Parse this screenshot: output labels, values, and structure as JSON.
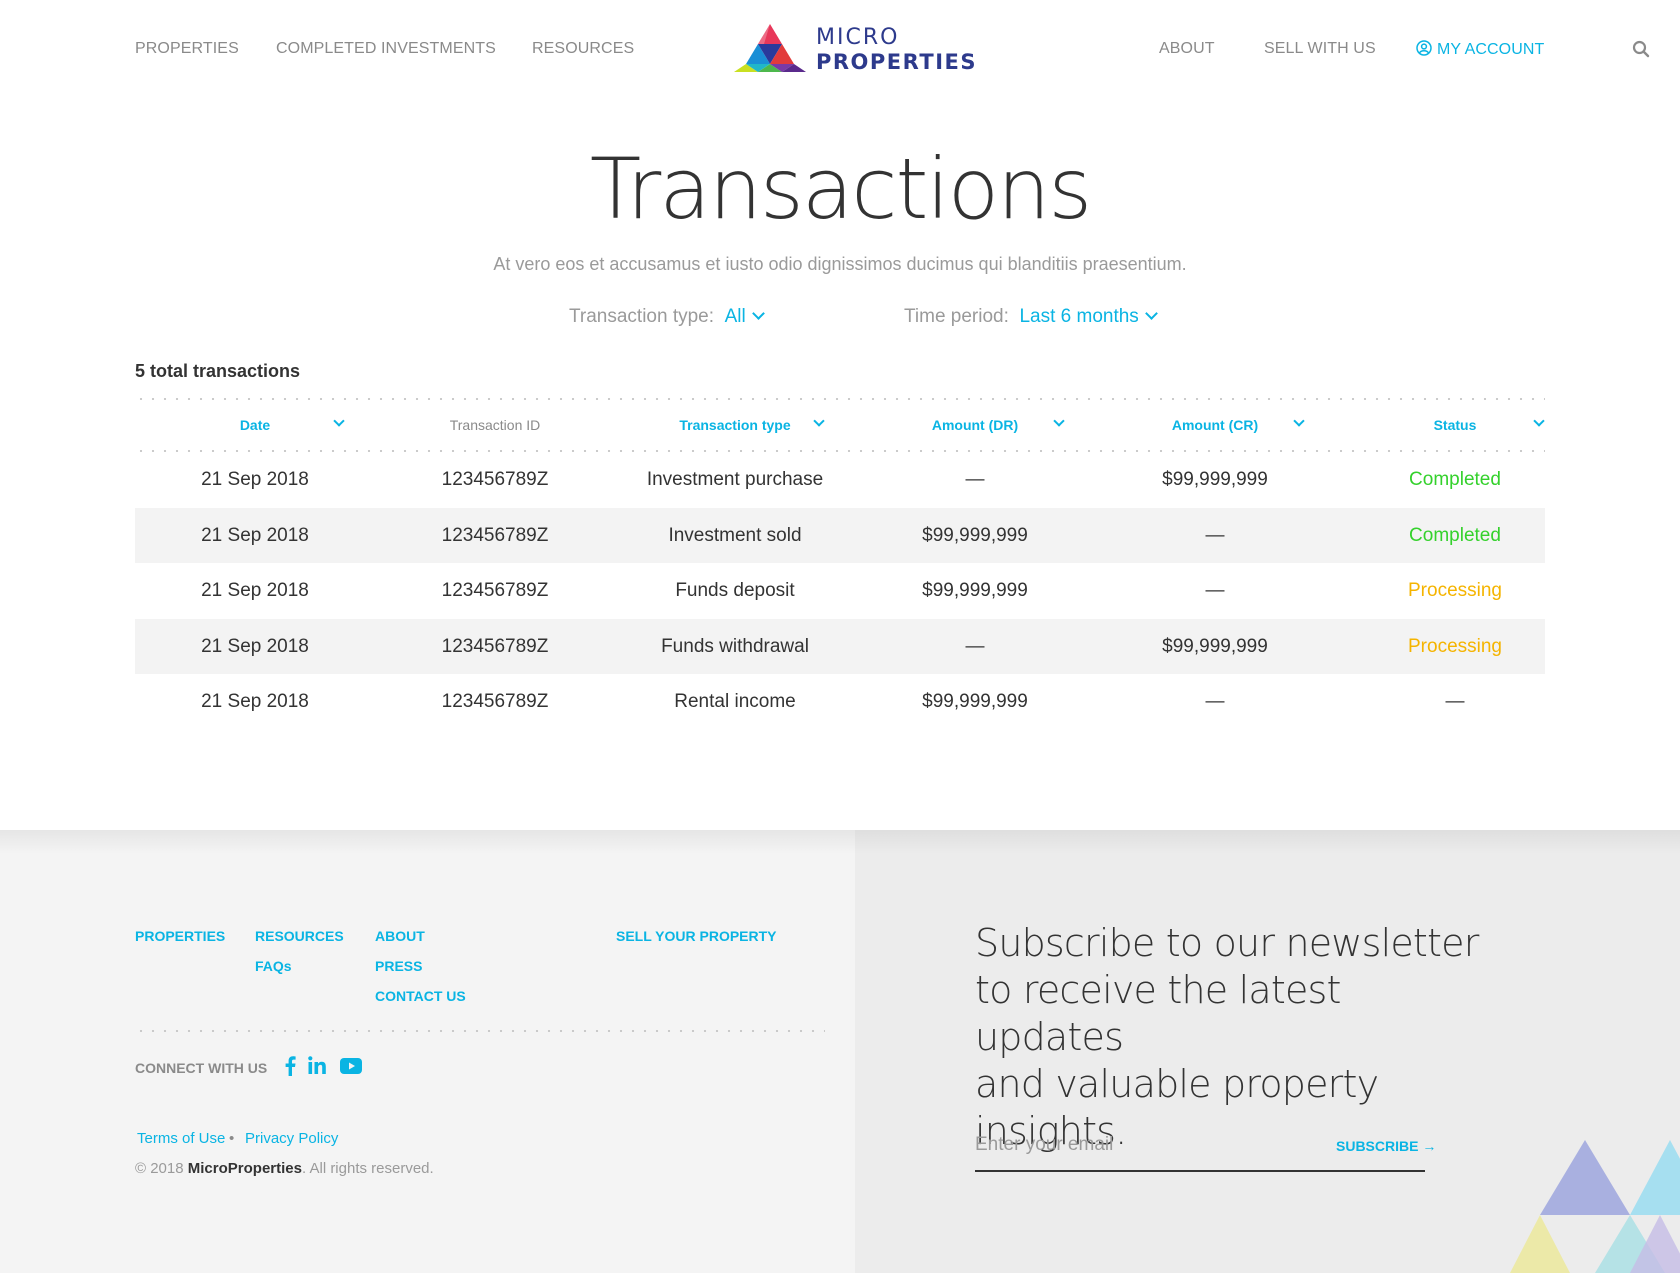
{
  "header": {
    "nav_left": [
      "PROPERTIES",
      "COMPLETED INVESTMENTS",
      "RESOURCES"
    ],
    "logo": {
      "line1": "MICRO",
      "line2": "PROPERTIES"
    },
    "nav_right": [
      "ABOUT",
      "SELL WITH US"
    ],
    "account": "MY ACCOUNT",
    "search_icon": "search-icon"
  },
  "hero": {
    "title": "Transactions",
    "subtitle": "At vero eos et accusamus et iusto odio dignissimos ducimus qui blanditiis praesentium."
  },
  "filters": {
    "type": {
      "label": "Transaction type:",
      "value": "All"
    },
    "period": {
      "label": "Time period:",
      "value": "Last 6 months"
    }
  },
  "total": "5 total transactions",
  "table": {
    "columns": [
      "Date",
      "Transaction ID",
      "Transaction type",
      "Amount (DR)",
      "Amount (CR)",
      "Status"
    ],
    "rows": [
      {
        "date": "21 Sep 2018",
        "id": "123456789Z",
        "type": "Investment purchase",
        "dr": "—",
        "cr": "$99,999,999",
        "status": "Completed"
      },
      {
        "date": "21 Sep 2018",
        "id": "123456789Z",
        "type": "Investment sold",
        "dr": "$99,999,999",
        "cr": "—",
        "status": "Completed"
      },
      {
        "date": "21 Sep 2018",
        "id": "123456789Z",
        "type": "Funds deposit",
        "dr": "$99,999,999",
        "cr": "—",
        "status": "Processing"
      },
      {
        "date": "21 Sep 2018",
        "id": "123456789Z",
        "type": "Funds withdrawal",
        "dr": "—",
        "cr": "$99,999,999",
        "status": "Processing"
      },
      {
        "date": "21 Sep 2018",
        "id": "123456789Z",
        "type": "Rental income",
        "dr": "$99,999,999",
        "cr": "—",
        "status": "—"
      }
    ]
  },
  "footer": {
    "links": {
      "properties": "PROPERTIES",
      "resources": "RESOURCES",
      "faqs": "FAQs",
      "about": "ABOUT",
      "press": "PRESS",
      "contact": "CONTACT US",
      "sell": "SELL YOUR PROPERTY"
    },
    "connect": "CONNECT WITH US",
    "social": [
      "facebook-icon",
      "linkedin-icon",
      "youtube-icon"
    ],
    "terms": "Terms of Use",
    "bullet": "•",
    "privacy": "Privacy Policy",
    "copyright_prefix": "© 2018",
    "copyright_brand": "MicroProperties",
    "copyright_suffix": ". All rights reserved."
  },
  "newsletter": {
    "line1": "Subscribe to our newsletter",
    "line2": "to receive the latest updates",
    "line3": "and valuable property insights.",
    "placeholder": "Enter your email",
    "subscribe": "SUBSCRIBE →"
  },
  "colors": {
    "accent": "#0ab4e3",
    "completed": "#34d12c",
    "processing": "#f5b400",
    "brand": "#2d3a8c"
  }
}
